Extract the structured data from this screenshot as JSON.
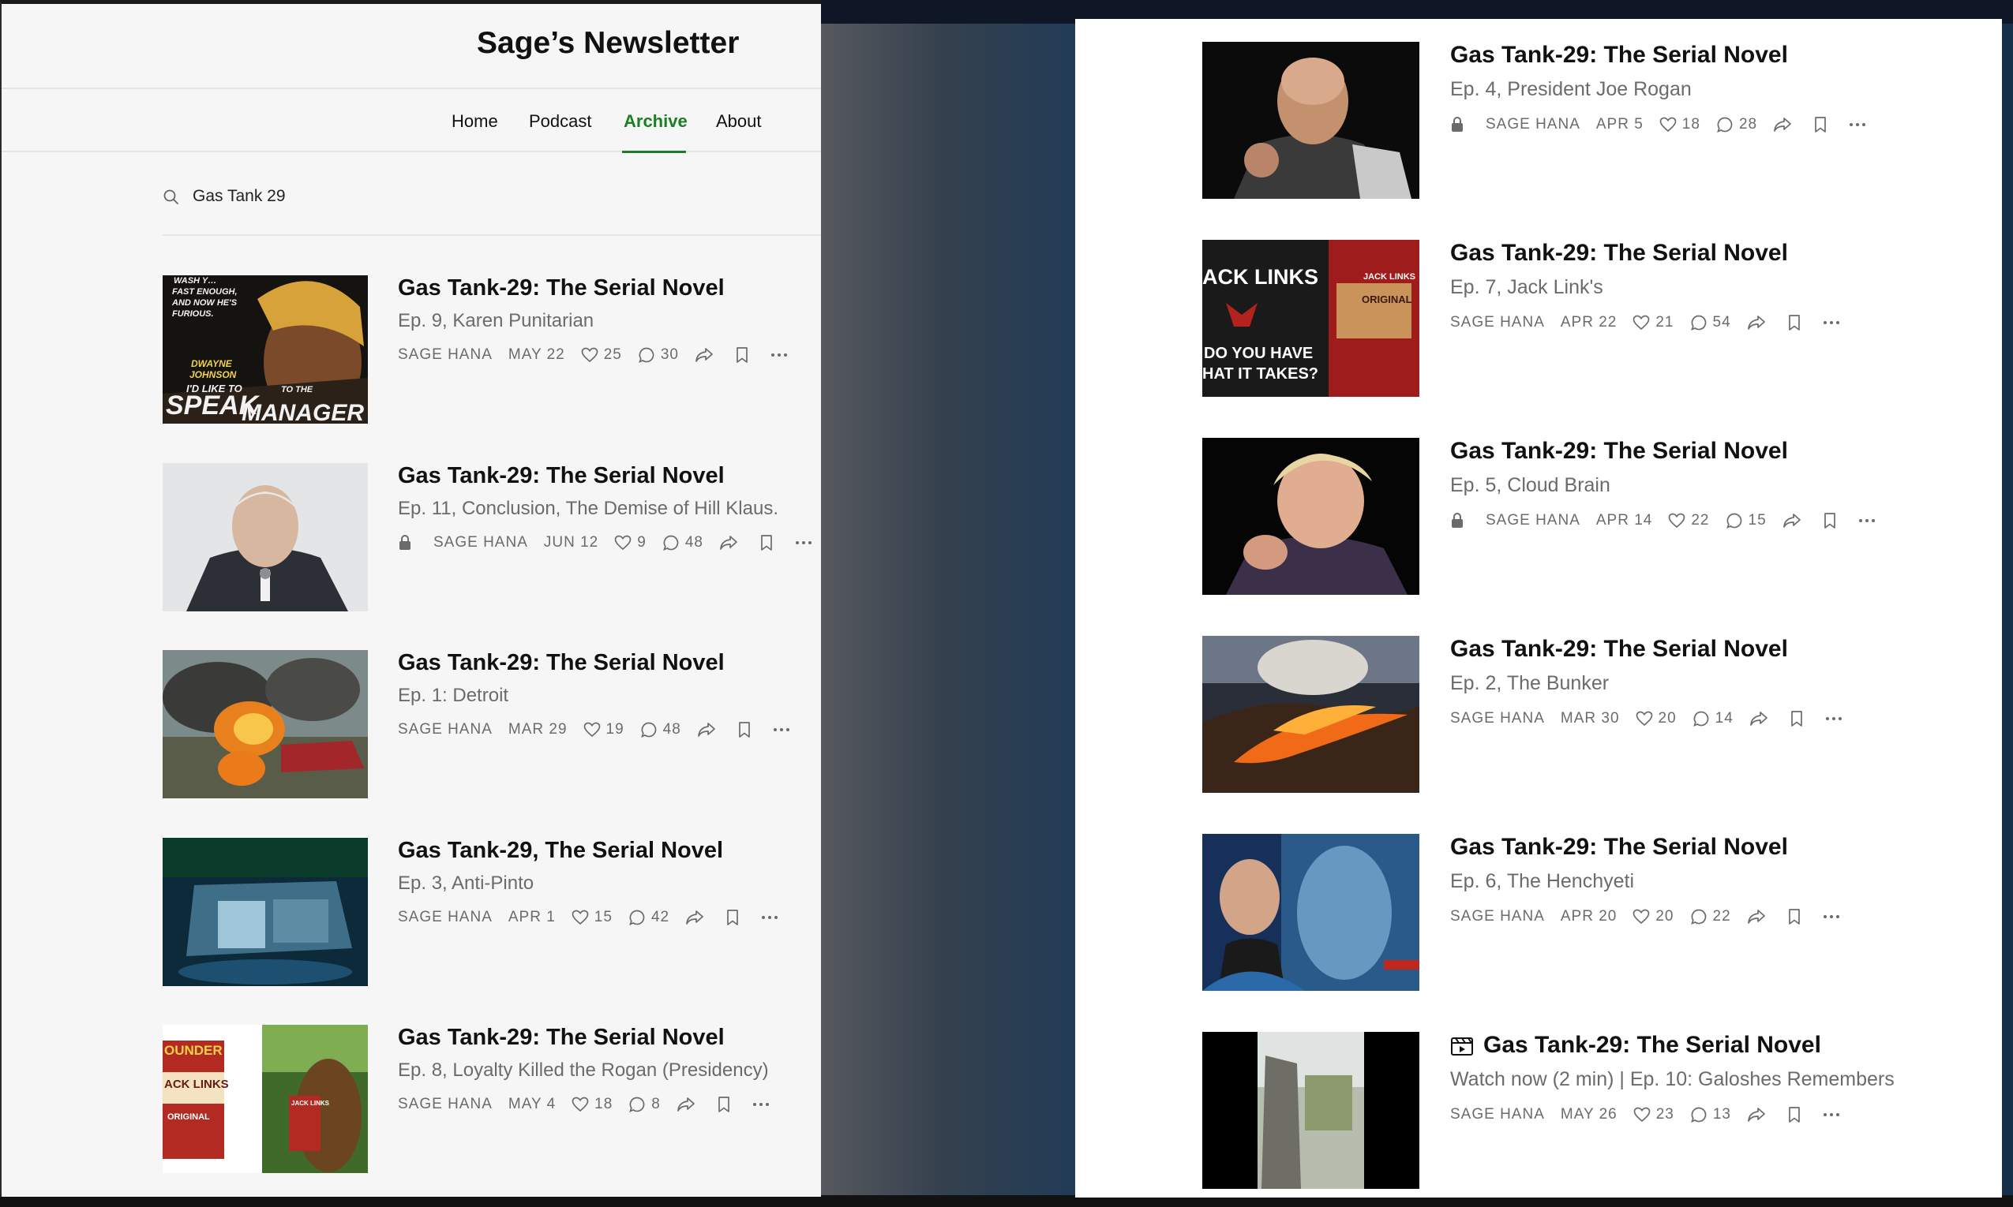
{
  "left": {
    "site_title": "Sage’s Newsletter",
    "nav": [
      "Home",
      "Podcast",
      "Archive",
      "About"
    ],
    "search_value": "Gas Tank 29",
    "posts": [
      {
        "title": "Gas Tank-29: The Serial Novel",
        "subtitle": "Ep. 9, Karen Punitarian",
        "author": "SAGE HANA",
        "date": "MAY 22",
        "likes": "25",
        "comments": "30",
        "locked": false,
        "thumb_text": [
          "WASH Y…",
          "FAST ENOUGH,",
          "AND NOW HE'S",
          "FURIOUS.",
          "DWAYNE",
          "JOHNSON",
          "I'D LIKE TO",
          "SPEAK",
          "TO THE",
          "MANAGER"
        ]
      },
      {
        "title": "Gas Tank-29: The Serial Novel",
        "subtitle": "Ep. 11, Conclusion, The Demise of Hill Klaus.",
        "author": "SAGE HANA",
        "date": "JUN 12",
        "likes": "9",
        "comments": "48",
        "locked": true
      },
      {
        "title": "Gas Tank-29: The Serial Novel",
        "subtitle": "Ep. 1: Detroit",
        "author": "SAGE HANA",
        "date": "MAR 29",
        "likes": "19",
        "comments": "48",
        "locked": false
      },
      {
        "title": "Gas Tank-29, The Serial Novel",
        "subtitle": "Ep. 3, Anti-Pinto",
        "author": "SAGE HANA",
        "date": "APR 1",
        "likes": "15",
        "comments": "42",
        "locked": false
      },
      {
        "title": "Gas Tank-29: The Serial Novel",
        "subtitle": "Ep. 8, Loyalty Killed the Rogan (Presidency)",
        "author": "SAGE HANA",
        "date": "MAY 4",
        "likes": "18",
        "comments": "8",
        "locked": false,
        "thumb_text": [
          "OUNDER",
          "ACK LINKS",
          "ORIGINAL",
          "JACK LINKS"
        ]
      }
    ]
  },
  "right": {
    "posts": [
      {
        "title": "Gas Tank-29: The Serial Novel",
        "subtitle": "Ep. 4, President Joe Rogan",
        "author": "SAGE HANA",
        "date": "APR 5",
        "likes": "18",
        "comments": "28",
        "locked": true
      },
      {
        "title": "Gas Tank-29: The Serial Novel",
        "subtitle": "Ep. 7, Jack Link's",
        "author": "SAGE HANA",
        "date": "APR 22",
        "likes": "21",
        "comments": "54",
        "locked": false,
        "thumb_text": [
          "ACK LINKS",
          "DO YOU HAVE",
          "HAT IT TAKES?",
          "JACK LINKS",
          "ORIGINAL"
        ]
      },
      {
        "title": "Gas Tank-29: The Serial Novel",
        "subtitle": "Ep. 5, Cloud Brain",
        "author": "SAGE HANA",
        "date": "APR 14",
        "likes": "22",
        "comments": "15",
        "locked": true
      },
      {
        "title": "Gas Tank-29: The Serial Novel",
        "subtitle": "Ep. 2, The Bunker",
        "author": "SAGE HANA",
        "date": "MAR 30",
        "likes": "20",
        "comments": "14",
        "locked": false
      },
      {
        "title": "Gas Tank-29: The Serial Novel",
        "subtitle": "Ep. 6, The Henchyeti",
        "author": "SAGE HANA",
        "date": "APR 20",
        "likes": "20",
        "comments": "22",
        "locked": false
      },
      {
        "title": "Gas Tank-29: The Serial Novel",
        "subtitle": "Watch now (2 min) | Ep. 10: Galoshes Remembers",
        "author": "SAGE HANA",
        "date": "MAY 26",
        "likes": "23",
        "comments": "13",
        "locked": false,
        "video": true
      }
    ]
  },
  "colors": {
    "accent": "#1a7f24",
    "meta": "#6b6b6b",
    "title": "#111111"
  },
  "icons": {
    "search": "search-icon",
    "like": "heart-icon",
    "comment": "comment-icon",
    "share": "share-icon",
    "bookmark": "bookmark-icon",
    "more": "more-icon",
    "lock": "lock-icon",
    "video": "video-icon"
  }
}
